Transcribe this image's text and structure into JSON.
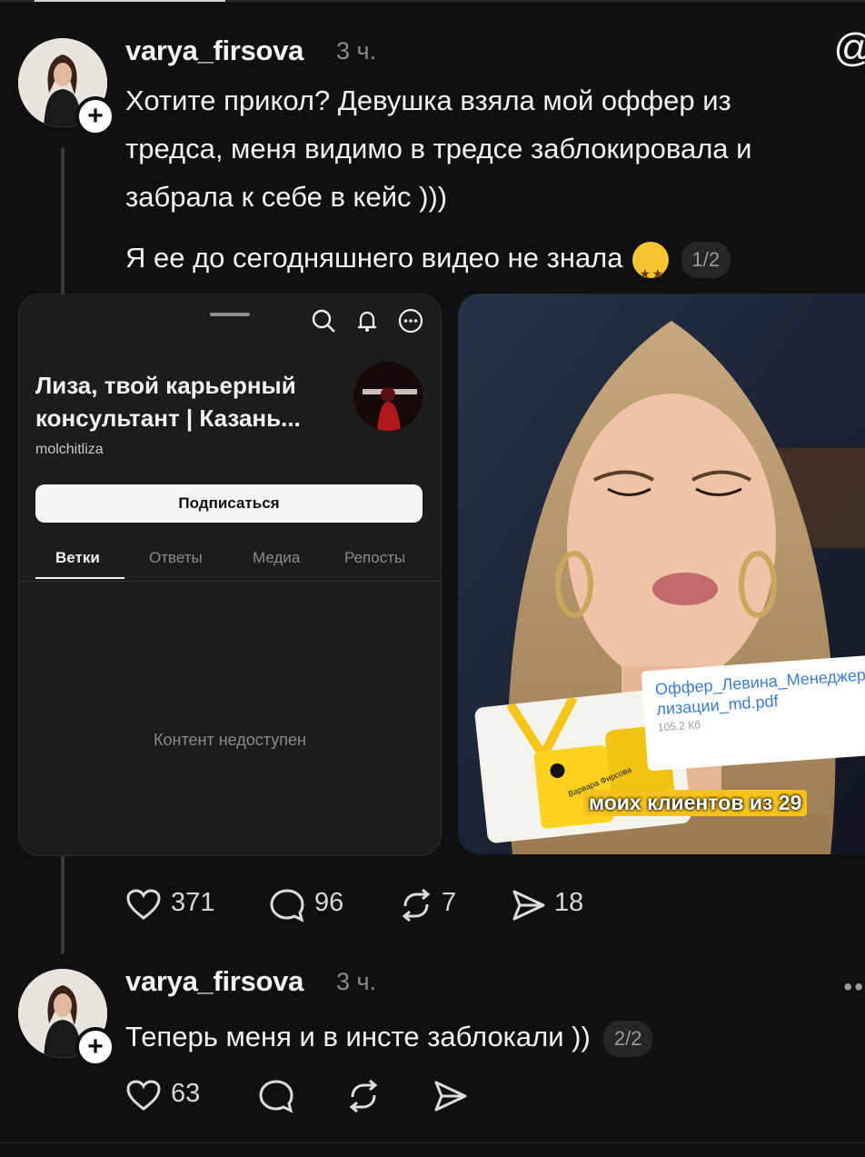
{
  "post1": {
    "username": "varya_firsova",
    "time": "3 ч.",
    "text_lines": [
      "Хотите прикол? Девушка взяла мой оффер из",
      "тредса, меня видимо в тредсе заблокировала и",
      "забрала к себе в кейс )))"
    ],
    "text2": "Я ее до сегодняшнего видео не знала",
    "counter": "1/2",
    "more_icon": "at-icon",
    "actions": {
      "likes": "371",
      "replies": "96",
      "reposts": "7",
      "shares": "18"
    }
  },
  "card1": {
    "profile_name": "Лиза, твой карьерный консультант | Казань...",
    "profile_handle": "molchitliza",
    "subscribe_label": "Подписаться",
    "tabs": [
      "Ветки",
      "Ответы",
      "Медиа",
      "Репосты"
    ],
    "active_tab": "Ветки",
    "empty_message": "Контент недоступен",
    "icons": [
      "search-icon",
      "bell-icon",
      "more-icon"
    ]
  },
  "card2": {
    "caption": "моих клиентов из 29",
    "pdf_name": "Оффер_Левина_Менеджер_реализации_md.pdf",
    "pdf_line1": "Оффер_Левина_Менеджер_реа",
    "pdf_line2": "лизации_md.pdf",
    "pdf_size": "105.2 Кб",
    "badge_text": "Варвара Фирсова"
  },
  "post2": {
    "username": "varya_firsova",
    "time": "3 ч.",
    "text": "Теперь меня и в инсте заблокали ))",
    "counter": "2/2",
    "more_icon": "more-dots-icon",
    "actions": {
      "likes": "63"
    }
  }
}
